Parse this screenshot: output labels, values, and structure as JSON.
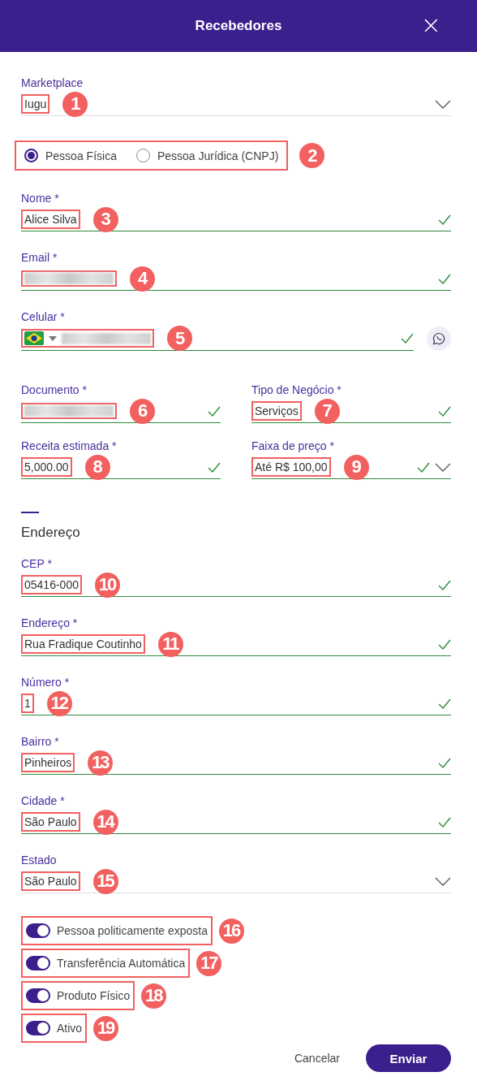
{
  "header": {
    "title": "Recebedores",
    "close_icon": "×"
  },
  "marketplace": {
    "label": "Marketplace",
    "value": "Iugu",
    "valid": false,
    "dropdown": true,
    "callout": "1"
  },
  "person_type": {
    "callout": "2",
    "options": [
      {
        "label": "Pessoa Física",
        "selected": true
      },
      {
        "label": "Pessoa Jurídica (CNPJ)",
        "selected": false
      }
    ]
  },
  "rows": [
    [
      {
        "kind": "text",
        "label": "Nome *",
        "value": "Alice Silva",
        "valid": true,
        "callout": "3"
      }
    ],
    [
      {
        "kind": "text",
        "label": "Email *",
        "redacted": true,
        "valid": true,
        "callout": "4"
      }
    ],
    [
      {
        "kind": "phone",
        "label": "Celular *",
        "redacted": true,
        "valid": true,
        "callout": "5"
      }
    ],
    [
      {
        "kind": "text",
        "label": "Documento *",
        "redacted": true,
        "valid": true,
        "callout": "6"
      },
      {
        "kind": "text",
        "label": "Tipo de Negócio *",
        "value": "Serviços",
        "valid": true,
        "callout": "7"
      }
    ],
    [
      {
        "kind": "text",
        "label": "Receita estimada *",
        "value": "5,000.00",
        "valid": true,
        "callout": "8"
      },
      {
        "kind": "text",
        "label": "Faixa de preço *",
        "value": "Até R$ 100,00",
        "valid": true,
        "dropdown": true,
        "callout": "9"
      }
    ]
  ],
  "address": {
    "title": "Endereço",
    "fields": [
      {
        "label": "CEP *",
        "value": "05416-000",
        "valid": true,
        "callout": "10"
      },
      {
        "label": "Endereço *",
        "value": "Rua Fradique Coutinho",
        "valid": true,
        "callout": "11"
      },
      {
        "label": "Número *",
        "value": "1",
        "valid": true,
        "callout": "12"
      },
      {
        "label": "Bairro *",
        "value": "Pinheiros",
        "valid": true,
        "callout": "13"
      },
      {
        "label": "Cidade *",
        "value": "São Paulo",
        "valid": true,
        "callout": "14"
      },
      {
        "label": "Estado",
        "value": "São Paulo",
        "valid": false,
        "dropdown": true,
        "callout": "15"
      }
    ]
  },
  "toggles": [
    {
      "label": "Pessoa politicamente exposta",
      "on": true,
      "callout": "16"
    },
    {
      "label": "Transferência Automática",
      "on": true,
      "callout": "17"
    },
    {
      "label": "Produto Físico",
      "on": true,
      "callout": "18"
    },
    {
      "label": "Ativo",
      "on": true,
      "callout": "19"
    }
  ],
  "actions": {
    "cancel": "Cancelar",
    "submit": "Enviar"
  }
}
